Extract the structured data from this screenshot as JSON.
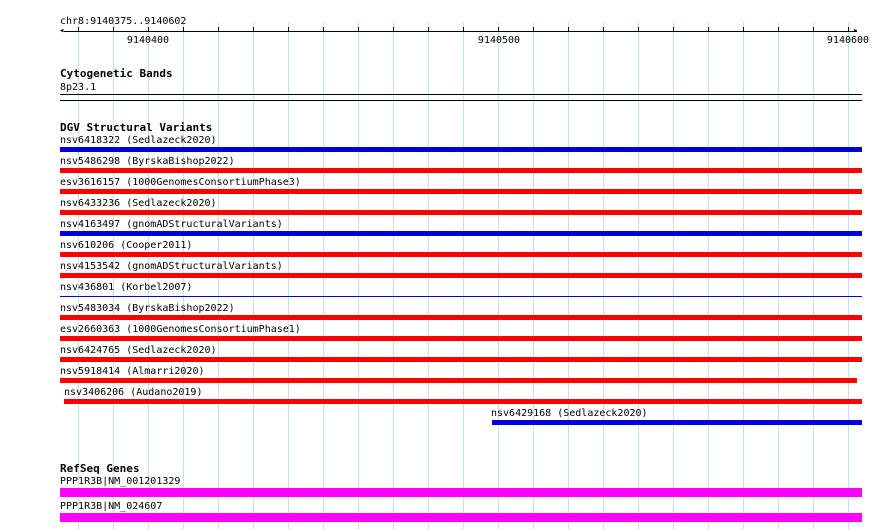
{
  "view": {
    "region_label": "chr8:9140375..9140602",
    "tick_labels": [
      "9140400",
      "9140500",
      "9140600"
    ]
  },
  "colors": {
    "grid": "#bfe3f7",
    "loss": "#ff0000",
    "gain": "#0000dd",
    "gene": "#ff00ff",
    "axis": "#000000"
  },
  "cytoband": {
    "title": "Cytogenetic Bands",
    "band": "8p23.1"
  },
  "dgv": {
    "title": "DGV Structural Variants",
    "variants": [
      {
        "label": "nsv6418322 (Sedlazeck2020)",
        "type": "gain"
      },
      {
        "label": "nsv5486298 (ByrskaBishop2022)",
        "type": "loss"
      },
      {
        "label": "esv3616157 (1000GenomesConsortiumPhase3)",
        "type": "loss"
      },
      {
        "label": "nsv6433236 (Sedlazeck2020)",
        "type": "loss"
      },
      {
        "label": "nsv4163497 (gnomADStructuralVariants)",
        "type": "gain"
      },
      {
        "label": "nsv610206 (Cooper2011)",
        "type": "loss"
      },
      {
        "label": "nsv4153542 (gnomADStructuralVariants)",
        "type": "loss"
      },
      {
        "label": "nsv436801 (Korbel2007)",
        "type": "thin-gain"
      },
      {
        "label": "nsv5483034 (ByrskaBishop2022)",
        "type": "loss"
      },
      {
        "label": "esv2660363 (1000GenomesConsortiumPhase1)",
        "type": "loss"
      },
      {
        "label": "nsv6424765 (Sedlazeck2020)",
        "type": "loss"
      },
      {
        "label": "nsv5918414 (Almarri2020)",
        "type": "loss"
      },
      {
        "label": "nsv3406206 (Audano2019)",
        "type": "loss"
      },
      {
        "label": "nsv6429168 (Sedlazeck2020)",
        "type": "gain"
      }
    ]
  },
  "refseq": {
    "title": "RefSeq Genes",
    "genes": [
      {
        "label": "PPP1R3B|NM_001201329"
      },
      {
        "label": "PPP1R3B|NM_024607"
      }
    ]
  }
}
